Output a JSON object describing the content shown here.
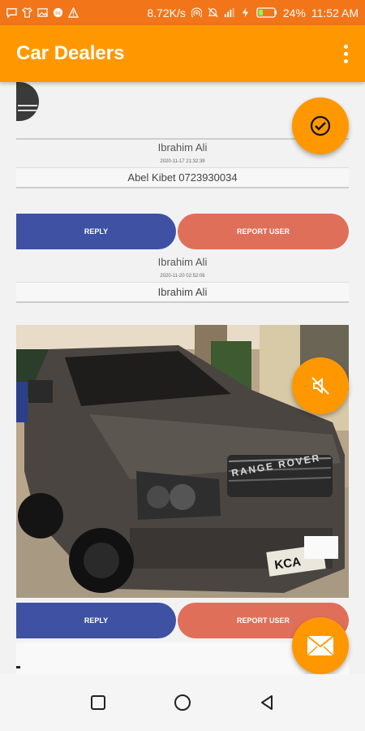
{
  "status_bar": {
    "network_speed": "8.72K/s",
    "battery": "24%",
    "time": "11:52 AM"
  },
  "app_bar": {
    "title": "Car Dealers"
  },
  "messages": [
    {
      "sender": "Ibrahim Ali",
      "timestamp": "2020-11-17 21:32:39",
      "content": "Abel Kibet 0723930034"
    },
    {
      "sender": "Ibrahim Ali",
      "timestamp": "2020-11-20 02:52:06",
      "content": "Ibrahim Ali"
    }
  ],
  "actions": {
    "reply_label": "REPLY",
    "report_label": "REPORT USER"
  },
  "car_photo": {
    "plate_text": "KCA",
    "badge_text": "RANGE ROVER"
  },
  "fabs": [
    {
      "icon": "check-circle-icon"
    },
    {
      "icon": "mute-icon"
    },
    {
      "icon": "mail-icon"
    }
  ],
  "colors": {
    "status_bar": "#f3751a",
    "app_bar": "#ff9800",
    "reply": "#3f51a3",
    "report": "#e06f5a"
  }
}
